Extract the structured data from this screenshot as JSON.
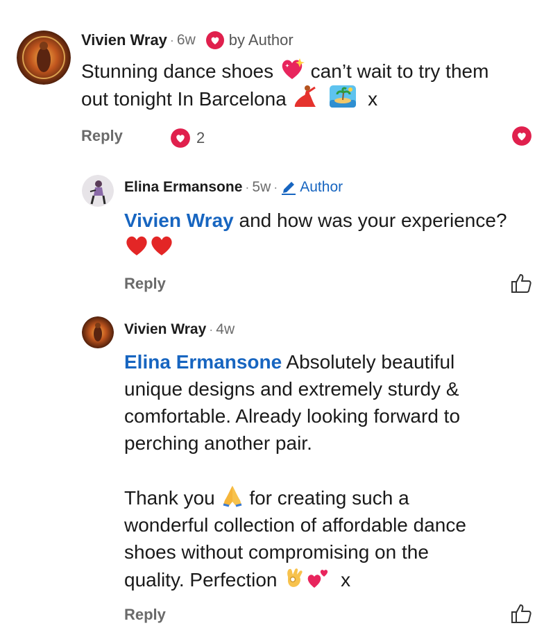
{
  "comments": [
    {
      "name": "Vivien Wray",
      "time": "6w",
      "badge": "by Author",
      "text_line1": "Stunning dance shoes",
      "text_line1b": "can’t wait to try them",
      "text_line2": "out tonight In Barcelona",
      "text_line2b": "x",
      "reply": "Reply",
      "likes": "2"
    },
    {
      "name": "Elina Ermansone",
      "time": "5w",
      "badge": "Author",
      "mention": "Vivien Wray",
      "text": "and how was your experience?",
      "reply": "Reply"
    },
    {
      "name": "Vivien Wray",
      "time": "4w",
      "mention": "Elina Ermansone",
      "p1_line1": "Absolutely beautiful",
      "p1_line2": "unique designs and extremely sturdy &",
      "p1_line3": "comfortable. Already looking forward to",
      "p1_line4": "perching another pair.",
      "p2_line1a": "Thank you",
      "p2_line1b": "for creating such a",
      "p2_line2": "wonderful collection of affordable dance",
      "p2_line3": "shoes without compromising on the",
      "p2_line4a": "quality. Perfection",
      "p2_line4b": "x",
      "reply": "Reply"
    }
  ],
  "colors": {
    "accent_red": "#e0204d",
    "mention_blue": "#1765c0",
    "muted": "#6b6b6b"
  }
}
